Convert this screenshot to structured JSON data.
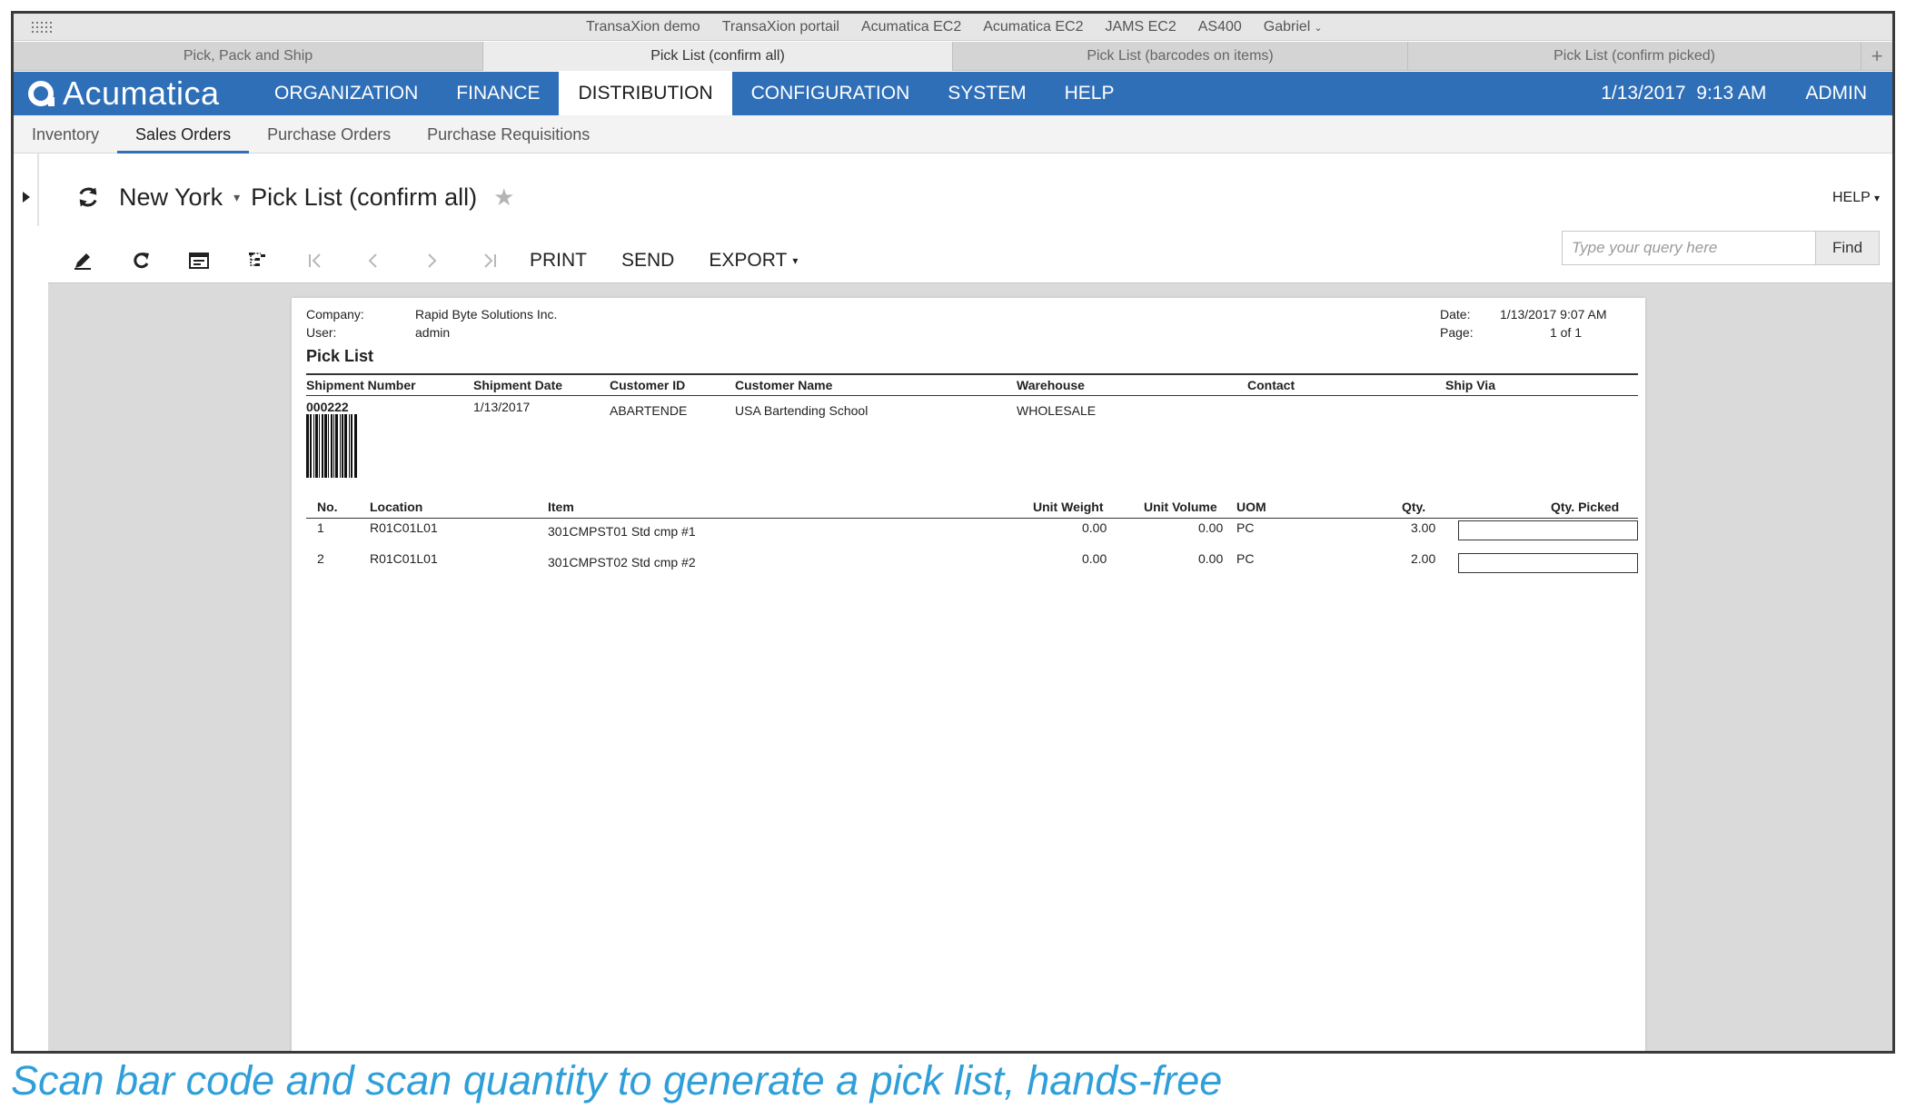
{
  "bookmarks": [
    "TransaXion demo",
    "TransaXion portail",
    "Acumatica EC2",
    "Acumatica EC2",
    "JAMS EC2",
    "AS400",
    "Gabriel"
  ],
  "browser_tabs": [
    {
      "label": "Pick, Pack and Ship",
      "active": false
    },
    {
      "label": "Pick List (confirm all)",
      "active": true
    },
    {
      "label": "Pick List (barcodes on items)",
      "active": false
    },
    {
      "label": "Pick List (confirm picked)",
      "active": false
    }
  ],
  "header": {
    "logo_text": "Acumatica",
    "menu": [
      "ORGANIZATION",
      "FINANCE",
      "DISTRIBUTION",
      "CONFIGURATION",
      "SYSTEM",
      "HELP"
    ],
    "active_menu": "DISTRIBUTION",
    "datetime": "1/13/2017  9:13 AM",
    "user": "ADMIN"
  },
  "sub_menu": {
    "items": [
      "Inventory",
      "Sales Orders",
      "Purchase Orders",
      "Purchase Requisitions"
    ],
    "active": "Sales Orders"
  },
  "page": {
    "branch": "New York",
    "title": "Pick List (confirm all)",
    "help": "HELP"
  },
  "toolbar": {
    "print": "PRINT",
    "send": "SEND",
    "export": "EXPORT",
    "search_placeholder": "Type your query here",
    "find": "Find"
  },
  "report": {
    "company_label": "Company:",
    "company": "Rapid Byte Solutions Inc.",
    "user_label": "User:",
    "user": "admin",
    "date_label": "Date:",
    "date": "1/13/2017 9:07 AM",
    "page_label": "Page:",
    "page": "1 of 1",
    "title": "Pick List",
    "shipment_headers": [
      "Shipment Number",
      "Shipment Date",
      "Customer ID",
      "Customer Name",
      "Warehouse",
      "Contact",
      "Ship Via"
    ],
    "shipment": {
      "number": "000222",
      "date": "1/13/2017",
      "customer_id": "ABARTENDE",
      "customer_name": "USA Bartending School",
      "warehouse": "WHOLESALE"
    },
    "line_headers": [
      "No.",
      "Location",
      "Item",
      "Unit Weight",
      "Unit Volume",
      "UOM",
      "Qty.",
      "Qty. Picked"
    ],
    "lines": [
      {
        "no": "1",
        "location": "R01C01L01",
        "item": "301CMPST01 Std cmp #1",
        "weight": "0.00",
        "volume": "0.00",
        "uom": "PC",
        "qty": "3.00"
      },
      {
        "no": "2",
        "location": "R01C01L01",
        "item": "301CMPST02 Std cmp #2",
        "weight": "0.00",
        "volume": "0.00",
        "uom": "PC",
        "qty": "2.00"
      }
    ]
  },
  "caption": "Scan bar code and scan quantity to generate a pick list, hands-free"
}
